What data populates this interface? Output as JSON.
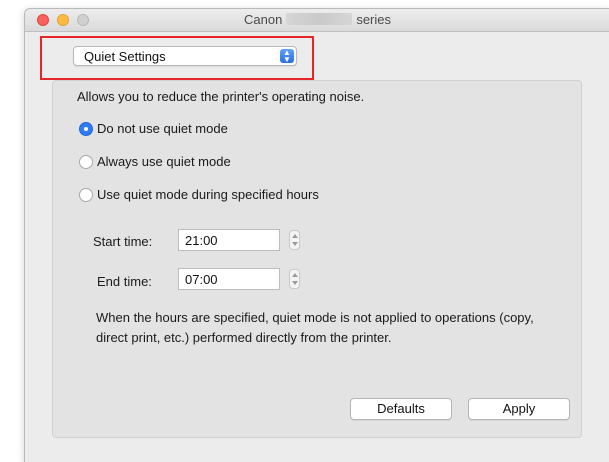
{
  "window": {
    "title_prefix": "Canon",
    "title_suffix": "series"
  },
  "popup": {
    "label": "Quiet Settings"
  },
  "panel": {
    "description": "Allows you to reduce the printer's operating noise.",
    "options": [
      {
        "label": "Do not use quiet mode",
        "selected": true
      },
      {
        "label": "Always use quiet mode",
        "selected": false
      },
      {
        "label": "Use quiet mode during specified hours",
        "selected": false
      }
    ],
    "start_time": {
      "label": "Start time:",
      "value": "21:00"
    },
    "end_time": {
      "label": "End time:",
      "value": "07:00"
    },
    "note": "When the hours are specified, quiet mode is not applied to operations (copy, direct print, etc.) performed directly from the printer."
  },
  "buttons": {
    "defaults": "Defaults",
    "apply": "Apply"
  },
  "colors": {
    "highlight": "#e8252a",
    "accent": "#2f7cf6"
  }
}
